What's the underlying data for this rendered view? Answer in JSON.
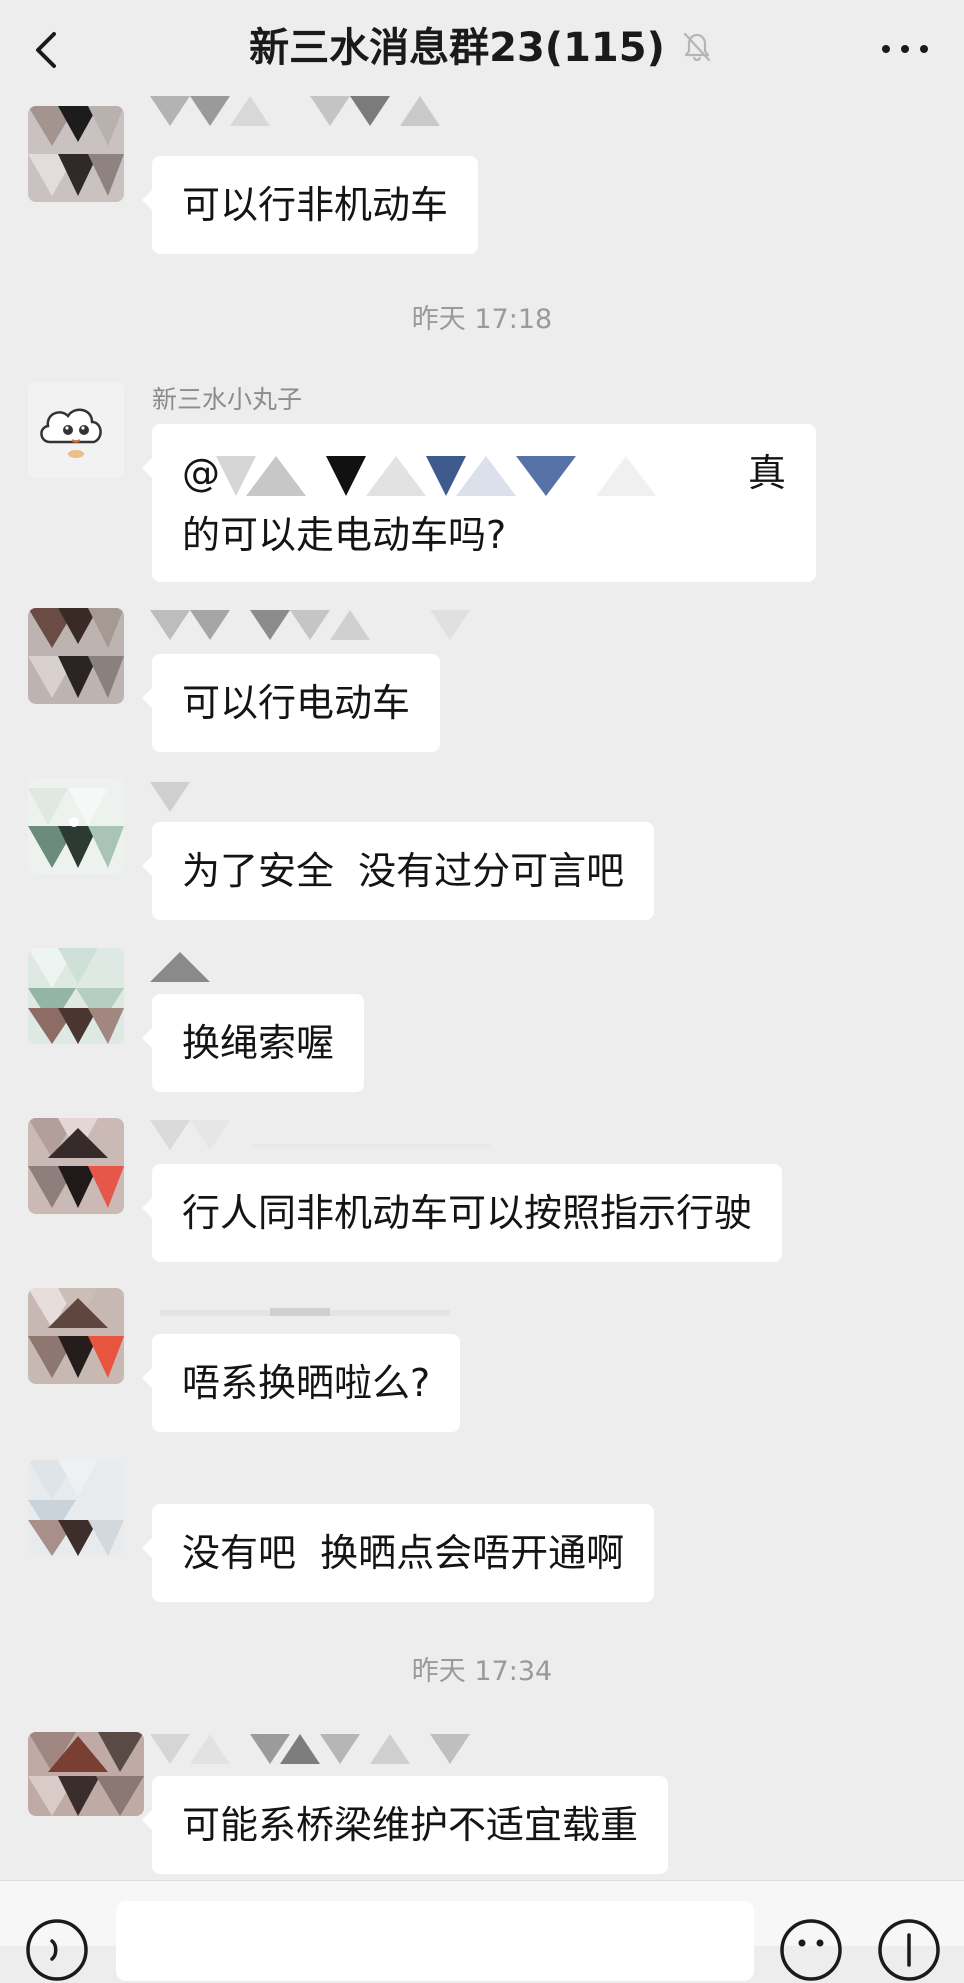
{
  "header": {
    "title": "新三水消息群23(115)",
    "back_icon": "chevron-left-icon",
    "mute_icon": "bell-slash-icon",
    "more_icon": "ellipsis-icon"
  },
  "messages": [
    {
      "text": "可以行非机动车"
    },
    {
      "time": "昨天 17:18"
    },
    {
      "nickname": "新三水小丸子",
      "text_line1_prefix": "@",
      "text_line1_suffix": "真",
      "text_line2": "的可以走电动车吗?"
    },
    {
      "text": "可以行电动车"
    },
    {
      "text": "为了安全  没有过分可言吧"
    },
    {
      "text": "换绳索喔"
    },
    {
      "text": "行人同非机动车可以按照指示行驶"
    },
    {
      "text": "唔系换晒啦么?"
    },
    {
      "text": "没有吧  换晒点会唔开通啊"
    },
    {
      "time": "昨天 17:34"
    },
    {
      "text": "可能系桥梁维护不适宜载重"
    }
  ],
  "composer": {
    "voice_icon": "voice-icon",
    "emoji_icon": "emoji-icon",
    "plus_icon": "plus-icon"
  },
  "colors": {
    "background": "#ededed",
    "bubble": "#ffffff",
    "timestamp": "#9a9a9a",
    "nickname": "#8c8c8c"
  }
}
